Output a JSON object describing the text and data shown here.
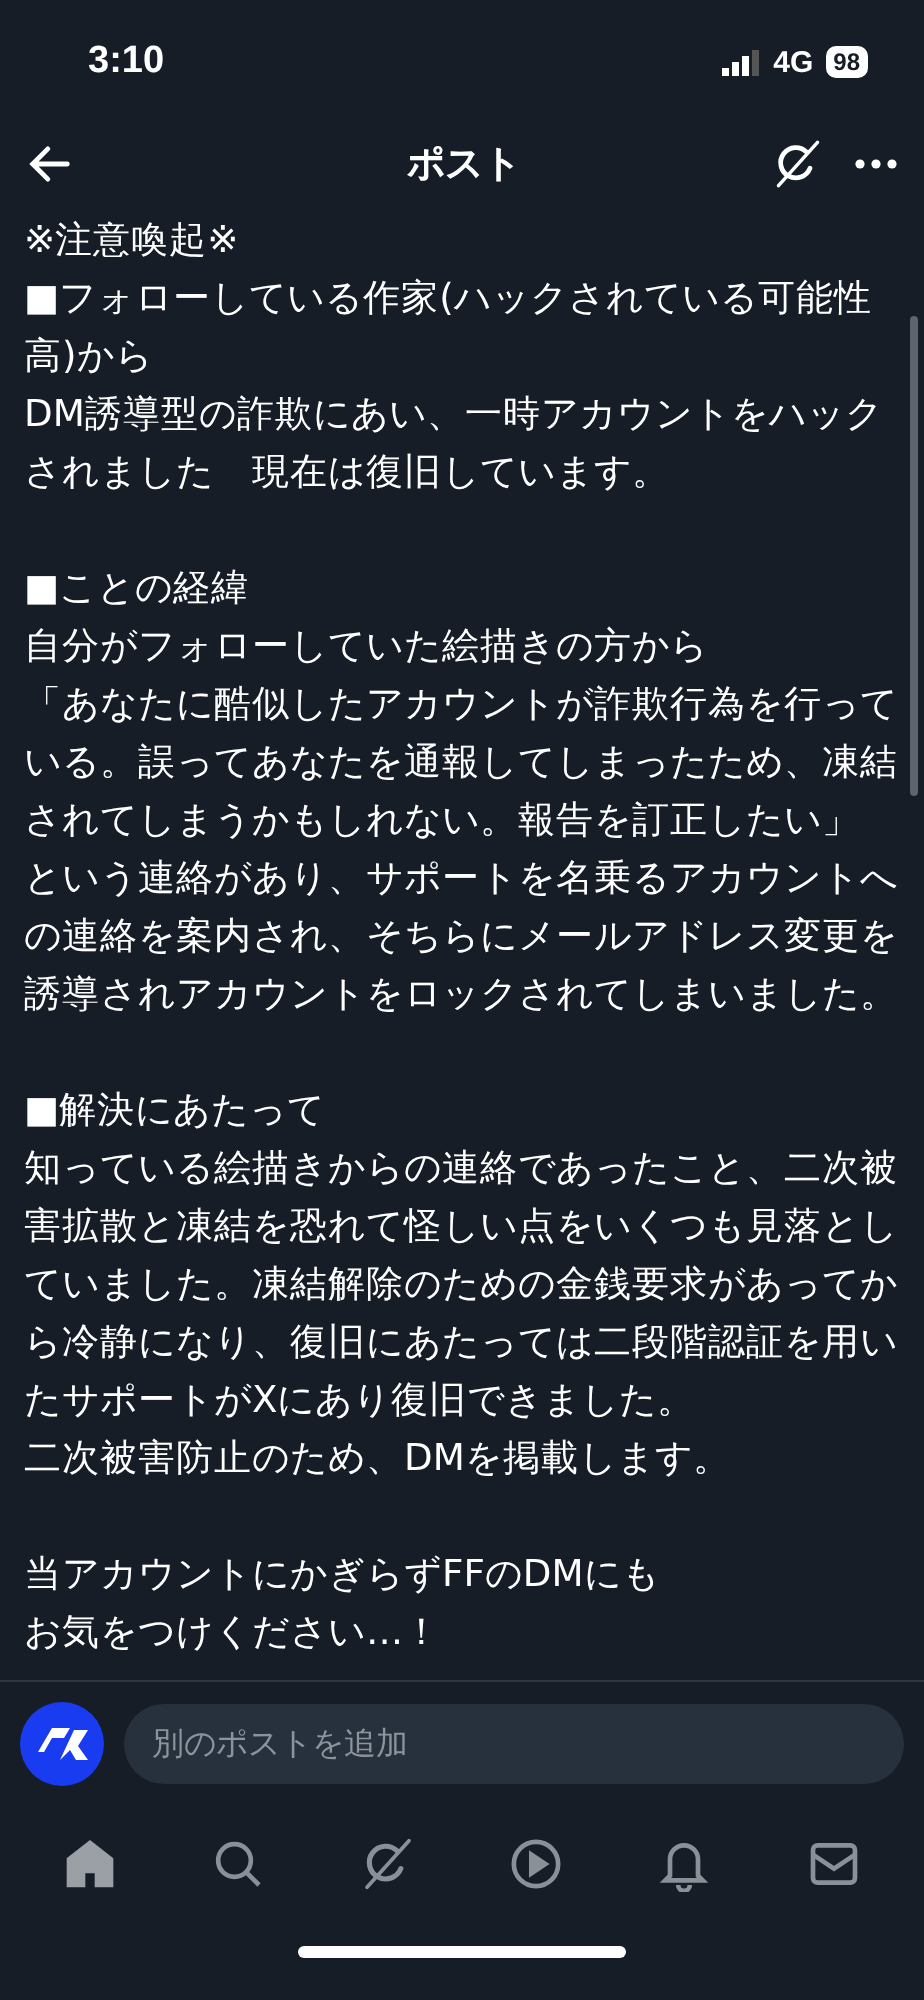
{
  "status_bar": {
    "time": "3:10",
    "network": "4G",
    "battery": "98"
  },
  "nav": {
    "title": "ポスト"
  },
  "post": {
    "paragraphs": [
      {
        "lines": [
          "※注意喚起※",
          "■フォローしている作家(ハックされている可能性高)から",
          "DM誘導型の詐欺にあい、一時アカウントをハックされました　現在は復旧しています。"
        ]
      },
      {
        "lines": [
          "■ことの経緯",
          "自分がフォローしていた絵描きの方から",
          "「あなたに酷似したアカウントが詐欺行為を行っている。誤ってあなたを通報してしまったため、凍結されてしまうかもしれない。報告を訂正したい」",
          "という連絡があり、サポートを名乗るアカウントへの連絡を案内され、そちらにメールアドレス変更を誘導されアカウントをロックされてしまいました。"
        ]
      },
      {
        "lines": [
          "■解決にあたって",
          "知っている絵描きからの連絡であったこと、二次被害拡散と凍結を恐れて怪しい点をいくつも見落としていました。凍結解除のための金銭要求があってから冷静になり、復旧にあたっては二段階認証を用いたサポートがXにあり復旧できました。",
          "二次被害防止のため、DMを掲載します。"
        ]
      },
      {
        "lines": [
          "当アカウントにかぎらずFFのDMにも",
          "お気をつけください…！"
        ]
      }
    ]
  },
  "composer": {
    "placeholder": "別のポストを追加"
  },
  "tab_bar": [
    {
      "kind": "home",
      "selected": true
    },
    {
      "kind": "search",
      "selected": false
    },
    {
      "kind": "grok",
      "selected": false
    },
    {
      "kind": "video",
      "selected": false
    },
    {
      "kind": "bell",
      "selected": false
    },
    {
      "kind": "mail",
      "selected": false
    }
  ]
}
